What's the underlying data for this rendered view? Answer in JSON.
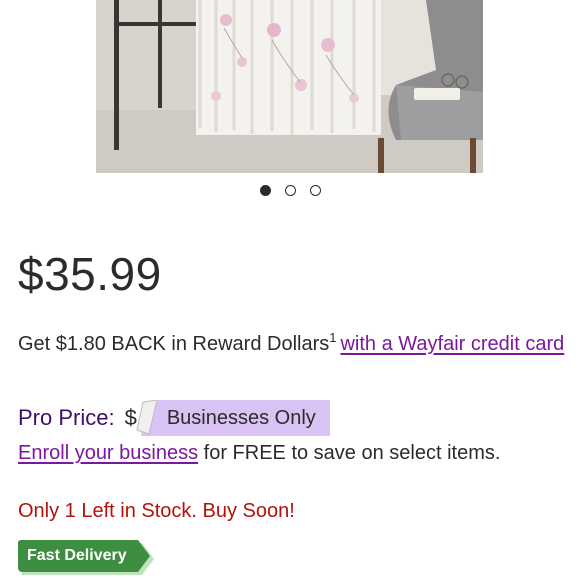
{
  "product_image": {
    "alt_icon": "product-photo-curtains"
  },
  "carousel": {
    "count": 3,
    "active_index": 0
  },
  "price": "$35.99",
  "reward": {
    "text": "Get $1.80 BACK in Reward Dollars",
    "footnote": "1",
    "link_text": "with a Wayfair credit card"
  },
  "pro_price": {
    "label": "Pro Price:",
    "currency": "$",
    "badge": "Businesses Only"
  },
  "enroll": {
    "link_text": "Enroll your business",
    "text": " for FREE to save on select items."
  },
  "stock_message": "Only 1 Left in Stock. Buy Soon!",
  "delivery_badge": "Fast Delivery",
  "colors": {
    "link": "#7b189f",
    "stock_warning": "#b3120c",
    "pro_badge_bg": "#d9c2f4",
    "delivery_green": "#3e8e41"
  }
}
